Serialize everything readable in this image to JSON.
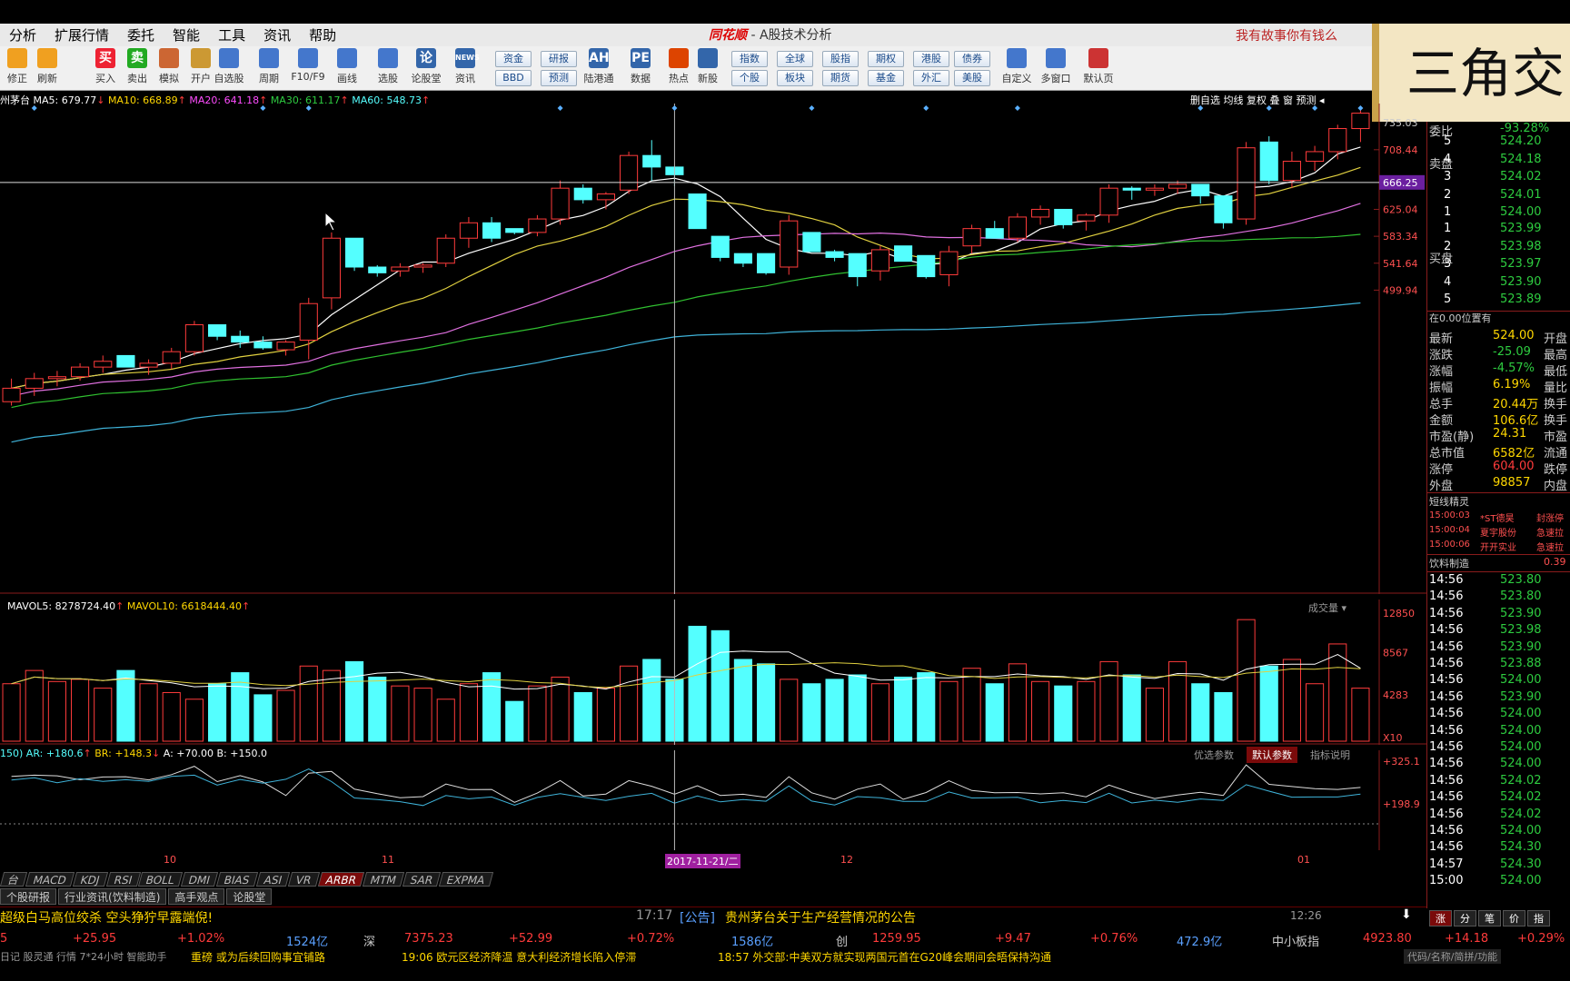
{
  "menu": [
    "分析",
    "扩展行情",
    "委托",
    "智能",
    "工具",
    "资讯",
    "帮助"
  ],
  "app": {
    "brand": "同花顺",
    "title": "- A股技术分析",
    "slogan": "我有故事你有钱么"
  },
  "overlay_text": "三角交",
  "toolbar": {
    "icons": [
      {
        "label": "修正",
        "icon": "up-arrow-icon",
        "color": "#f0a020"
      },
      {
        "label": "刷新",
        "icon": "refresh-icon",
        "color": "#f0a020"
      },
      {
        "label": "买入",
        "icon": "buy-icon",
        "text": "买",
        "color": "#e23"
      },
      {
        "label": "卖出",
        "icon": "sell-icon",
        "text": "卖",
        "color": "#2a2"
      },
      {
        "label": "模拟",
        "icon": "hammer-icon",
        "color": "#c63"
      },
      {
        "label": "开户",
        "icon": "lock-icon",
        "color": "#c93"
      },
      {
        "label": "自选股",
        "icon": "star-icon",
        "color": "#47c"
      },
      {
        "label": "周期",
        "icon": "clock-icon",
        "color": "#47c"
      },
      {
        "label": "F10/F9",
        "icon": "doc-icon",
        "color": "#47c"
      },
      {
        "label": "画线",
        "icon": "pen-icon",
        "color": "#47c"
      },
      {
        "label": "选股",
        "icon": "screen-icon",
        "color": "#47c"
      },
      {
        "label": "论股堂",
        "icon": "chat-icon",
        "text": "论",
        "color": "#36a"
      },
      {
        "label": "资讯",
        "icon": "news-icon",
        "text": "NEWS",
        "color": "#36a"
      },
      {
        "label": "陆港通",
        "icon": "ah-icon",
        "text": "AH",
        "color": "#36a"
      },
      {
        "label": "数据",
        "icon": "pe-icon",
        "text": "PE",
        "color": "#36a"
      },
      {
        "label": "热点",
        "icon": "fire-icon",
        "color": "#d40"
      },
      {
        "label": "新股",
        "icon": "newstock-icon",
        "color": "#36a"
      },
      {
        "label": "自定义",
        "icon": "custom-icon",
        "color": "#47c"
      },
      {
        "label": "多窗口",
        "icon": "windows-icon",
        "color": "#47c"
      },
      {
        "label": "默认页",
        "icon": "home-icon",
        "color": "#c33"
      }
    ],
    "buttons": [
      "资金",
      "BBD",
      "研报",
      "预测",
      "指数",
      "个股",
      "全球",
      "板块",
      "股指",
      "期货",
      "期权",
      "基金",
      "港股",
      "外汇",
      "债券",
      "美股"
    ]
  },
  "infobar": {
    "name": "州茅台",
    "ma5": "MA5: 679.77",
    "ma10": "MA10: 668.89",
    "ma20": "MA20: 641.18",
    "ma30": "MA30: 611.17",
    "ma60": "MA60: 548.73",
    "right": "删自选 均线 复权 叠 窗 预测 ◂"
  },
  "price_axis": [
    "735.03",
    "708.44",
    "666.25",
    "625.04",
    "583.34",
    "541.64",
    "499.94"
  ],
  "vol_info": {
    "mavol5": "MAVOL5: 8278724.40",
    "mavol10": "MAVOL10: 6618444.40",
    "dropdown": "成交量"
  },
  "vol_axis": [
    "12850",
    "8567",
    "4283",
    "X10"
  ],
  "arbr_info": {
    "param": "150)",
    "ar": "AR: +180.6",
    "br": "BR: +148.3",
    "a": "A: +70.00",
    "b": "B: +150.0",
    "btns": [
      "优选参数",
      "默认参数",
      "指标说明"
    ]
  },
  "arbr_axis": [
    "+325.1",
    "+198.9"
  ],
  "date_axis": [
    "10",
    "11",
    "2017-11-21/二",
    "12",
    "01"
  ],
  "indicator_tabs": [
    "台",
    "MACD",
    "KDJ",
    "RSI",
    "BOLL",
    "DMI",
    "BIAS",
    "ASI",
    "VR",
    "ARBR",
    "MTM",
    "SAR",
    "EXPMA"
  ],
  "sub_tabs": [
    "个股研报",
    "行业资讯(饮料制造)",
    "高手观点",
    "论股堂"
  ],
  "news": {
    "left": "超级白马高位绞杀 空头狰狞早露端倪!",
    "time": "17:17",
    "tag": "[公告]",
    "text": "贵州茅台关于生产经营情况的公告",
    "clock": "12:26"
  },
  "ticker": [
    "5",
    "+25.95",
    "+1.02%",
    "1524亿",
    "深",
    "7375.23",
    "+52.99",
    "+0.72%",
    "1586亿",
    "创",
    "1259.95",
    "+9.47",
    "+0.76%",
    "472.9亿",
    "中小板指",
    "4923.80",
    "+14.18",
    "+0.29%"
  ],
  "ticker2": {
    "lbls": [
      "日记",
      "股灵通",
      "行情",
      "7*24小时",
      "智能助手"
    ],
    "n1": "重磅 或为后续回购事宜铺路",
    "n2": "19:06 欧元区经济降温 意大利经济增长陷入停滞",
    "n3": "18:57 外交部:中美双方就实现两国元首在G20峰会期间会晤保持沟通",
    "right": "代码/名称/简拼/功能"
  },
  "quote": {
    "wb": "委比",
    "wb_val": "-93.28%",
    "sell_lbl": "卖盘",
    "buy_lbl": "买盘",
    "sells": [
      [
        "5",
        "524.20"
      ],
      [
        "4",
        "524.18"
      ],
      [
        "3",
        "524.02"
      ],
      [
        "2",
        "524.01"
      ],
      [
        "1",
        "524.00"
      ]
    ],
    "buys": [
      [
        "1",
        "523.99"
      ],
      [
        "2",
        "523.98"
      ],
      [
        "3",
        "523.97"
      ],
      [
        "4",
        "523.90"
      ],
      [
        "5",
        "523.89"
      ]
    ],
    "pos": "在0.00位置有",
    "stats": [
      [
        "最新",
        "524.00",
        "开盘"
      ],
      [
        "涨跌",
        "-25.09",
        "最高"
      ],
      [
        "涨幅",
        "-4.57%",
        "最低"
      ],
      [
        "振幅",
        "6.19%",
        "量比"
      ],
      [
        "总手",
        "20.44万",
        "换手"
      ],
      [
        "金额",
        "106.6亿",
        "换手"
      ],
      [
        "市盈(静)",
        "24.31",
        "市盈"
      ],
      [
        "总市值",
        "6582亿",
        "流通"
      ],
      [
        "涨停",
        "604.00",
        "跌停"
      ],
      [
        "外盘",
        "98857",
        "内盘"
      ]
    ],
    "elves_title": "短线精灵",
    "elves": [
      [
        "15:00:03",
        "*ST德昊",
        "封涨停"
      ],
      [
        "15:00:04",
        "夏宇股份",
        "急速拉"
      ],
      [
        "15:00:06",
        "开开实业",
        "急速拉"
      ]
    ],
    "industry": "饮料制造",
    "industry_val": "0.39",
    "ticks": [
      [
        "14:56",
        "523.80"
      ],
      [
        "14:56",
        "523.80"
      ],
      [
        "14:56",
        "523.90"
      ],
      [
        "14:56",
        "523.98"
      ],
      [
        "14:56",
        "523.90"
      ],
      [
        "14:56",
        "523.88"
      ],
      [
        "14:56",
        "524.00"
      ],
      [
        "14:56",
        "523.90"
      ],
      [
        "14:56",
        "524.00"
      ],
      [
        "14:56",
        "524.00"
      ],
      [
        "14:56",
        "524.00"
      ],
      [
        "14:56",
        "524.00"
      ],
      [
        "14:56",
        "524.02"
      ],
      [
        "14:56",
        "524.02"
      ],
      [
        "14:56",
        "524.02"
      ],
      [
        "14:56",
        "524.00"
      ],
      [
        "14:56",
        "524.30"
      ],
      [
        "14:57",
        "524.30"
      ],
      [
        "15:00",
        "524.00"
      ]
    ],
    "bottom_tabs": [
      "涨",
      "分",
      "笔",
      "价",
      "指"
    ]
  },
  "chart_data": {
    "type": "candlestick",
    "ylim": [
      490,
      745
    ],
    "candles": [
      [
        590,
        602,
        588,
        597
      ],
      [
        597,
        605,
        593,
        602
      ],
      [
        602,
        606,
        598,
        603
      ],
      [
        603,
        610,
        601,
        608
      ],
      [
        608,
        614,
        605,
        611
      ],
      [
        614,
        614,
        608,
        608
      ],
      [
        608,
        612,
        604,
        610
      ],
      [
        610,
        618,
        607,
        616
      ],
      [
        616,
        632,
        614,
        630
      ],
      [
        630,
        627,
        622,
        624
      ],
      [
        624,
        627,
        618,
        621
      ],
      [
        621,
        624,
        617,
        618
      ],
      [
        617,
        622,
        614,
        621
      ],
      [
        622,
        644,
        612,
        641
      ],
      [
        644,
        678,
        638,
        675
      ],
      [
        675,
        673,
        658,
        660
      ],
      [
        660,
        661,
        655,
        657
      ],
      [
        658,
        662,
        655,
        660
      ],
      [
        660,
        662,
        657,
        661
      ],
      [
        662,
        677,
        660,
        675
      ],
      [
        675,
        686,
        670,
        683
      ],
      [
        683,
        686,
        673,
        675
      ],
      [
        680,
        680,
        677,
        678
      ],
      [
        678,
        687,
        676,
        685
      ],
      [
        685,
        705,
        682,
        701
      ],
      [
        701,
        703,
        693,
        695
      ],
      [
        695,
        699,
        690,
        698
      ],
      [
        700,
        720,
        698,
        718
      ],
      [
        718,
        726,
        705,
        712
      ],
      [
        712,
        710,
        702,
        708
      ],
      [
        698,
        695,
        680,
        680
      ],
      [
        676,
        672,
        663,
        665
      ],
      [
        667,
        667,
        660,
        662
      ],
      [
        667,
        665,
        656,
        657
      ],
      [
        660,
        687,
        656,
        684
      ],
      [
        678,
        676,
        668,
        668
      ],
      [
        668,
        669,
        663,
        665
      ],
      [
        667,
        665,
        650,
        655
      ],
      [
        658,
        671,
        653,
        669
      ],
      [
        671,
        670,
        665,
        663
      ],
      [
        666,
        664,
        654,
        655
      ],
      [
        656,
        671,
        650,
        668
      ],
      [
        671,
        682,
        667,
        680
      ],
      [
        680,
        684,
        675,
        675
      ],
      [
        675,
        688,
        673,
        686
      ],
      [
        686,
        692,
        682,
        690
      ],
      [
        690,
        688,
        680,
        682
      ],
      [
        684,
        688,
        679,
        687
      ],
      [
        687,
        703,
        683,
        701
      ],
      [
        701,
        702,
        695,
        700
      ],
      [
        700,
        703,
        697,
        701
      ],
      [
        701,
        705,
        698,
        703
      ],
      [
        703,
        700,
        693,
        697
      ],
      [
        697,
        689,
        680,
        683
      ],
      [
        685,
        725,
        682,
        722
      ],
      [
        725,
        728,
        703,
        705
      ],
      [
        705,
        720,
        701,
        715
      ],
      [
        715,
        723,
        710,
        720
      ],
      [
        720,
        734,
        716,
        732
      ],
      [
        732,
        742,
        725,
        740
      ]
    ],
    "volume": [
      2600,
      3200,
      2700,
      2800,
      2400,
      3200,
      2600,
      2200,
      1900,
      2600,
      3100,
      2100,
      2300,
      3400,
      3200,
      3600,
      2900,
      2500,
      2400,
      1900,
      2600,
      3100,
      1800,
      2500,
      2900,
      2200,
      2400,
      3400,
      3700,
      2800,
      5200,
      5000,
      3700,
      3500,
      2800,
      2600,
      2800,
      3000,
      2600,
      2900,
      3100,
      2700,
      3300,
      2600,
      3500,
      2700,
      2500,
      2700,
      3600,
      3000,
      2400,
      3600,
      2600,
      2200,
      5500,
      3400,
      3700,
      2600,
      4400,
      2400
    ],
    "ma_colors": [
      "#ffffff",
      "#e0d040",
      "#e070e0",
      "#30c030",
      "#3fb3d9"
    ]
  }
}
